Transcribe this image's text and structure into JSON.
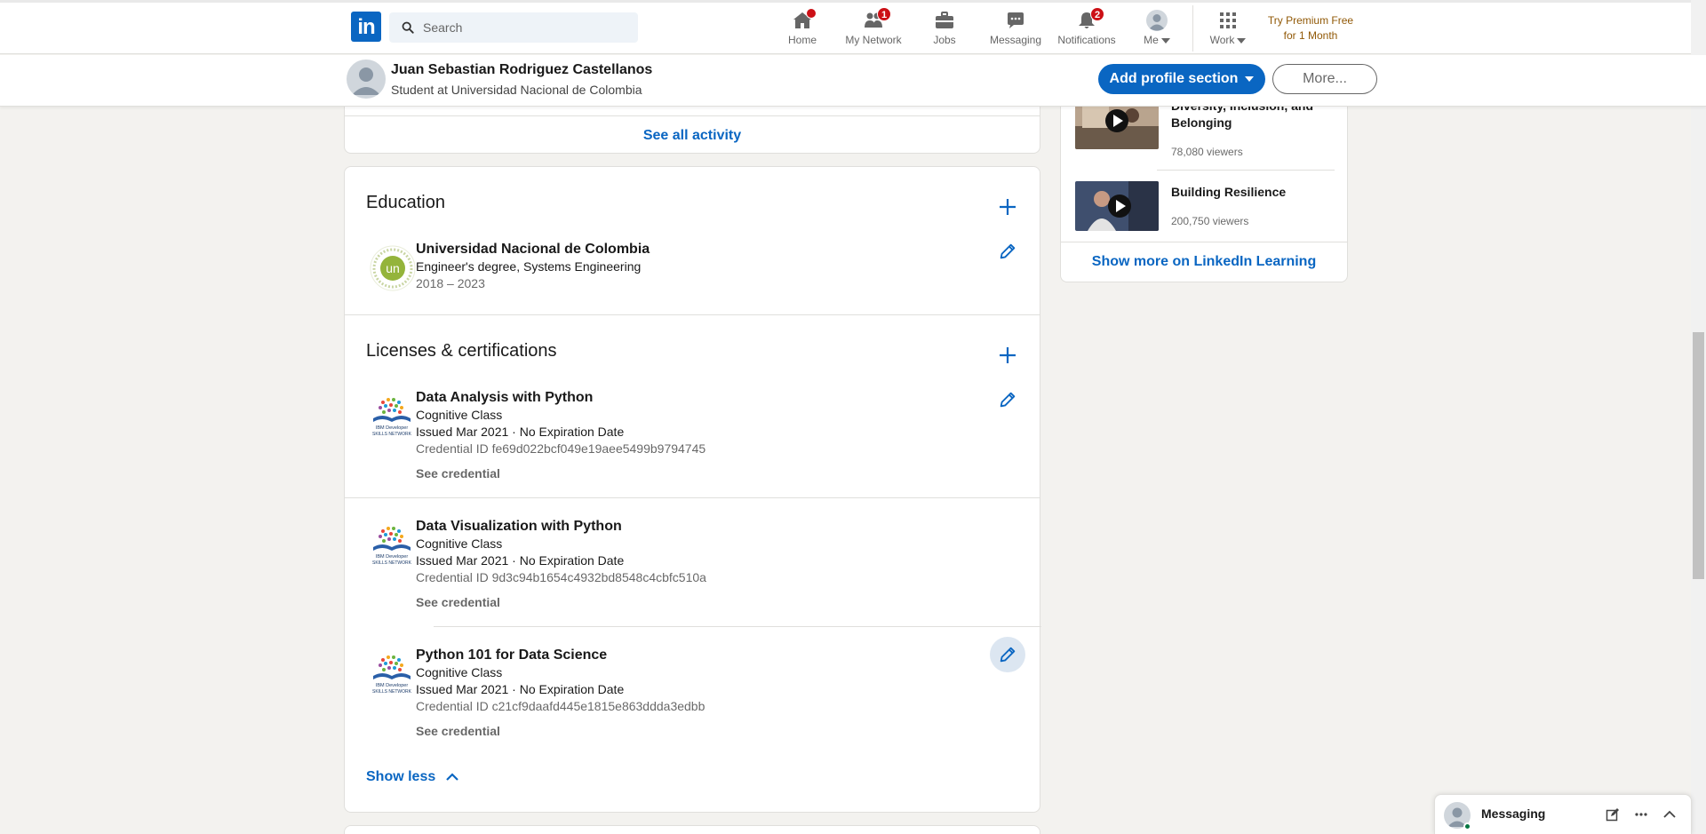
{
  "nav": {
    "search_placeholder": "Search",
    "items": [
      {
        "label": "Home",
        "icon": "home-icon",
        "badge": ""
      },
      {
        "label": "My Network",
        "icon": "network-icon",
        "badge": "1"
      },
      {
        "label": "Jobs",
        "icon": "briefcase-icon",
        "badge": ""
      },
      {
        "label": "Messaging",
        "icon": "chat-icon",
        "badge": ""
      },
      {
        "label": "Notifications",
        "icon": "bell-icon",
        "badge": "2"
      },
      {
        "label": "Me",
        "icon": "avatar",
        "badge": ""
      },
      {
        "label": "Work",
        "icon": "grid-icon",
        "badge": ""
      }
    ],
    "premium_line1": "Try Premium Free",
    "premium_line2": "for 1 Month"
  },
  "profile": {
    "name": "Juan Sebastian Rodriguez Castellanos",
    "headline": "Student at Universidad Nacional de Colombia",
    "add_section_label": "Add profile section",
    "more_label": "More..."
  },
  "activity": {
    "see_all_label": "See all activity"
  },
  "education": {
    "title": "Education",
    "entries": [
      {
        "school": "Universidad Nacional de Colombia",
        "degree": "Engineer's degree, Systems Engineering",
        "dates": "2018 – 2023",
        "logo_text": "un"
      }
    ]
  },
  "licenses": {
    "title": "Licenses & certifications",
    "entries": [
      {
        "name": "Data Analysis with Python",
        "issuer": "Cognitive Class",
        "issued": "Issued Mar 2021 · No Expiration Date",
        "credential": "Credential ID fe69d022bcf049e19aee5499b9794745",
        "link": "See credential"
      },
      {
        "name": "Data Visualization with Python",
        "issuer": "Cognitive Class",
        "issued": "Issued Mar 2021 · No Expiration Date",
        "credential": "Credential ID 9d3c94b1654c4932bd8548c4cbfc510a",
        "link": "See credential"
      },
      {
        "name": "Python 101 for Data Science",
        "issuer": "Cognitive Class",
        "issued": "Issued Mar 2021 · No Expiration Date",
        "credential": "Credential ID c21cf9daafd445e1815e863ddda3edbb",
        "link": "See credential"
      }
    ],
    "logo_line1": "IBM Developer",
    "logo_line2": "SKILLS NETWORK",
    "show_less_label": "Show less"
  },
  "learning": {
    "courses": [
      {
        "title": "Diversity, Inclusion, and Belonging",
        "viewers": "78,080 viewers"
      },
      {
        "title": "Building Resilience",
        "viewers": "200,750 viewers"
      }
    ],
    "show_more_label": "Show more on LinkedIn Learning"
  },
  "messaging": {
    "title": "Messaging"
  },
  "colors": {
    "brand": "#0a66c2",
    "badge": "#cc1016",
    "premium": "#915907",
    "online": "#057642"
  }
}
